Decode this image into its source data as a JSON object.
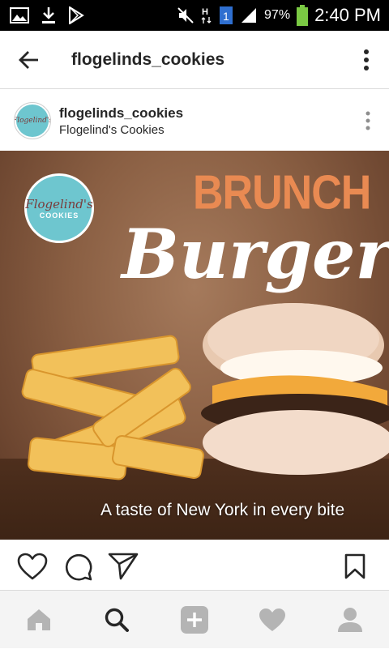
{
  "status_bar": {
    "battery_percent": "97%",
    "time": "2:40 PM",
    "icons": [
      "image-icon",
      "download-icon",
      "play-store-icon",
      "mute-icon",
      "hspa-icon",
      "sim1-icon",
      "signal-icon",
      "battery-icon"
    ]
  },
  "app_bar": {
    "title": "flogelinds_cookies",
    "icons": [
      "back-arrow-icon",
      "more-vertical-icon"
    ]
  },
  "post": {
    "username": "flogelinds_cookies",
    "subtitle": "Flogelind's Cookies",
    "avatar_text": "Flogelind's",
    "image": {
      "logo_text_1": "Flogelind's",
      "logo_text_2": "COOKIES",
      "headline_top": "BRUNCH",
      "headline_main": "Burger",
      "tagline": "A taste of New York in every bite"
    },
    "actions": [
      "like-icon",
      "comment-icon",
      "share-icon",
      "bookmark-icon"
    ]
  },
  "bottom_nav": {
    "items": [
      "home-icon",
      "search-icon",
      "add-icon",
      "activity-icon",
      "profile-icon"
    ],
    "active": "search-icon"
  },
  "colors": {
    "accent_orange": "#e98a52",
    "logo_teal": "#6ec6cf",
    "text": "#262626",
    "nav_inactive": "#b4b4b4",
    "nav_active": "#262626"
  }
}
